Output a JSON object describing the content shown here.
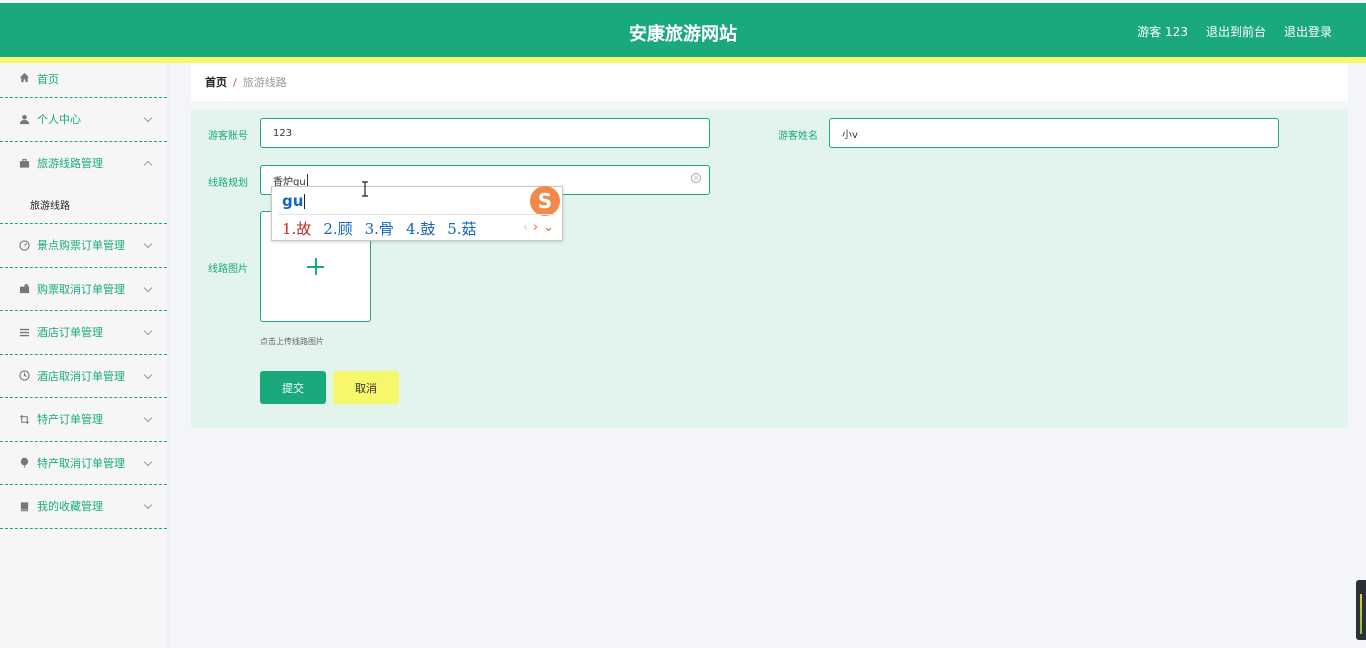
{
  "header": {
    "site_title": "安康旅游网站",
    "user_label": "游客 123",
    "back_to_front": "退出到前台",
    "logout": "退出登录"
  },
  "sidebar": {
    "items": [
      {
        "label": "首页",
        "icon": "home-icon"
      },
      {
        "label": "个人中心",
        "icon": "user-icon"
      },
      {
        "label": "旅游线路管理",
        "icon": "briefcase-icon",
        "expanded": true
      },
      {
        "label": "景点购票订单管理",
        "icon": "gauge-icon"
      },
      {
        "label": "购票取消订单管理",
        "icon": "ticket-icon"
      },
      {
        "label": "酒店订单管理",
        "icon": "list-icon"
      },
      {
        "label": "酒店取消订单管理",
        "icon": "clock-icon"
      },
      {
        "label": "特产订单管理",
        "icon": "crop-icon"
      },
      {
        "label": "特产取消订单管理",
        "icon": "balloon-icon"
      },
      {
        "label": "我的收藏管理",
        "icon": "bookmark-icon"
      }
    ],
    "sub_items": [
      {
        "label": "旅游线路"
      }
    ]
  },
  "breadcrumb": {
    "home": "首页",
    "separator": "/",
    "current": "旅游线路"
  },
  "form": {
    "account_label": "游客账号",
    "account_value": "123",
    "name_label": "游客姓名",
    "name_value": "小v",
    "route_label": "线路规划",
    "route_value": "香炉gu",
    "image_label": "线路图片",
    "upload_tip": "点击上传线路图片",
    "submit_label": "提交",
    "cancel_label": "取消"
  },
  "ime": {
    "composition": "gu",
    "candidates": [
      "1.故",
      "2.顾",
      "3.骨",
      "4.鼓",
      "5.菇"
    ],
    "logo_glyph": "S"
  },
  "colors": {
    "primary": "#1aa97c",
    "accent_yellow": "#f6f76a",
    "panel_bg": "#e2f4ec"
  }
}
